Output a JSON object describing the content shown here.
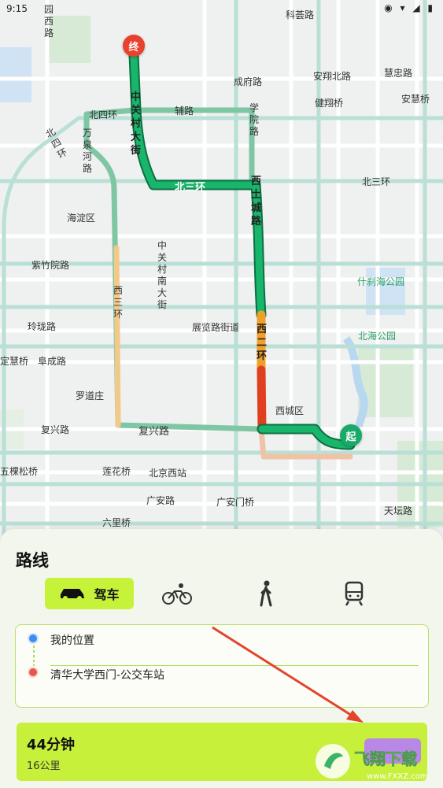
{
  "status_bar": {
    "time": "9:15",
    "icons": "◉ ▾ ◢ ▮"
  },
  "map": {
    "roads": {
      "kehui": "科荟路",
      "yuanxi": "园西路",
      "beisihuan_v": "北四环",
      "wanquanhe": "万泉河路",
      "beisihuan_h": "北四环",
      "fulu": "辅路",
      "xueyuan": "学院路",
      "chengfu": "成府路",
      "anxiangbei": "安翔北路",
      "huizhong": "慧忠路",
      "jianxiang": "健翔桥",
      "anhuiqiao": "安慧桥",
      "zhongguancun": "中关村大街",
      "beisanhuan_route": "北三环",
      "xitucheng": "西土城路",
      "beisanhuan_east": "北三环",
      "haidian": "海淀区",
      "zizhuyuan": "紫竹院路",
      "zhongguancun_nan": "中关村南大街",
      "shichahai": "什刹海公园",
      "xisanhuan": "西三环",
      "linglong": "玲珑路",
      "zhanlan": "展览路街道",
      "beihai": "北海公园",
      "dinghuiqiao": "定慧桥",
      "fucheng": "阜成路",
      "xierhuan": "西二环",
      "luodaozhuang": "罗道庄",
      "xicheng": "西城区",
      "fuxing_left": "复兴路",
      "fuxing_route": "复兴路",
      "wukeqiao": "五棵松桥",
      "lianhuaqiao": "莲花桥",
      "beijingxizhan": "北京西站",
      "guanganlu": "广安路",
      "guanganmen": "广安门桥",
      "liuliqiao": "六里桥",
      "tiantanlu": "天坛路"
    },
    "markers": {
      "end": "终",
      "start": "起"
    }
  },
  "sheet": {
    "title": "路线",
    "modes": [
      {
        "name": "drive",
        "label": "驾车",
        "active": true
      },
      {
        "name": "bike",
        "label": "",
        "active": false
      },
      {
        "name": "walk",
        "label": "",
        "active": false
      },
      {
        "name": "transit",
        "label": "",
        "active": false
      }
    ],
    "from": "我的位置",
    "to": "清华大学西门-公交车站",
    "result": {
      "time": "44分钟",
      "distance": "16公里"
    }
  },
  "watermark": {
    "text": "飞翔下载",
    "url": "www.FXXZ.com"
  },
  "colors": {
    "accent": "#c6f23a",
    "route_green": "#18b66a",
    "route_red": "#e0401f",
    "route_orange": "#f0a02a",
    "alt_route": "#7fc6a4"
  }
}
